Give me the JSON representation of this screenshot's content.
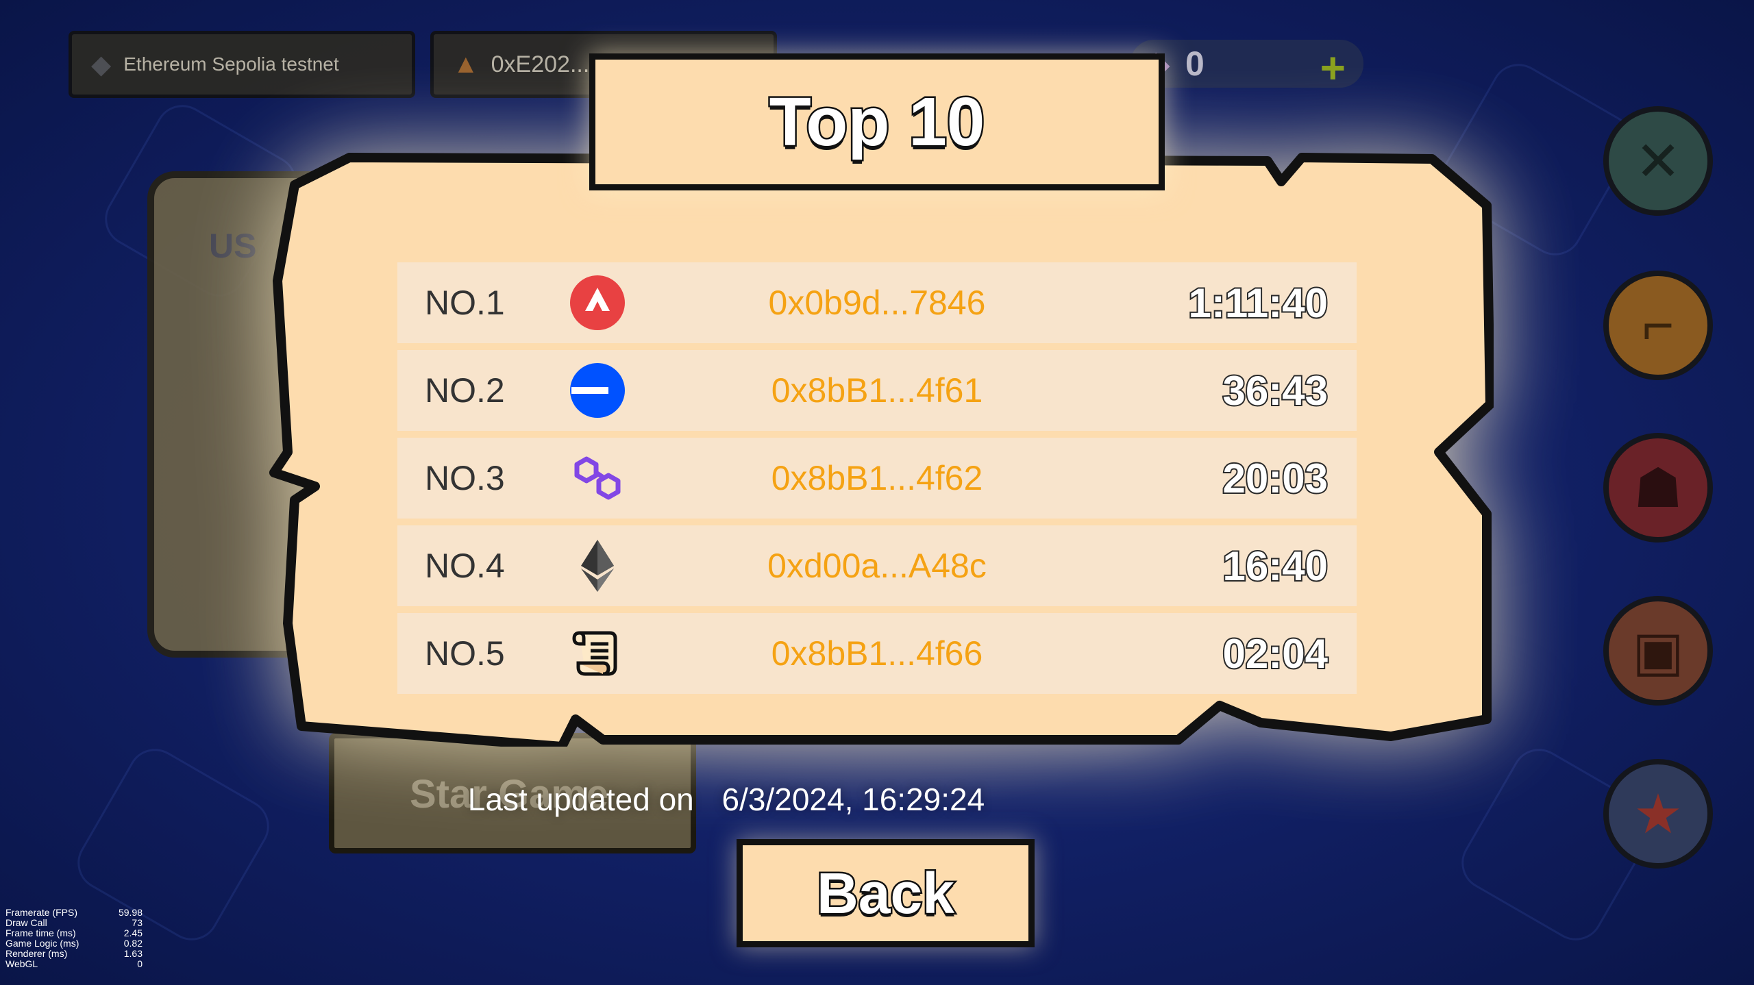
{
  "topbar": {
    "network_label": "Ethereum Sepolia testnet",
    "wallet_label": "0xE202...",
    "gem_count": "0",
    "plus_label": "+"
  },
  "background": {
    "panel_title": "US",
    "star_game_label": "Star Game"
  },
  "leaderboard": {
    "title": "Top 10",
    "rows": [
      {
        "rank": "NO.1",
        "chain_icon": "avalanche-icon",
        "address": "0x0b9d...7846",
        "time": "1:11:40"
      },
      {
        "rank": "NO.2",
        "chain_icon": "base-icon",
        "address": "0x8bB1...4f61",
        "time": "36:43"
      },
      {
        "rank": "NO.3",
        "chain_icon": "polygon-icon",
        "address": "0x8bB1...4f62",
        "time": "20:03"
      },
      {
        "rank": "NO.4",
        "chain_icon": "ethereum-icon",
        "address": "0xd00a...A48c",
        "time": "16:40"
      },
      {
        "rank": "NO.5",
        "chain_icon": "scroll-icon",
        "address": "0x8bB1...4f66",
        "time": "02:04"
      }
    ],
    "updated_prefix": "Last updated on",
    "updated_value": "6/3/2024, 16:29:24",
    "back_label": "Back"
  },
  "side_buttons": [
    {
      "name": "crossed-swords-icon",
      "color": "#2e4a46"
    },
    {
      "name": "blaster-gun-icon",
      "color": "#8a5a20"
    },
    {
      "name": "masked-warrior-icon",
      "color": "#6a2228"
    },
    {
      "name": "gift-box-icon",
      "color": "#6a3a2a"
    },
    {
      "name": "star-icon",
      "color": "#2f3a5a"
    }
  ],
  "stats": [
    {
      "label": "Framerate (FPS)",
      "value": "59.98"
    },
    {
      "label": "Draw Call",
      "value": "73"
    },
    {
      "label": "Frame time (ms)",
      "value": "2.45"
    },
    {
      "label": "Game Logic (ms)",
      "value": "0.82"
    },
    {
      "label": "Renderer (ms)",
      "value": "1.63"
    },
    {
      "label": "WebGL",
      "value": "0"
    }
  ],
  "colors": {
    "parchment": "#fddcae",
    "row": "#f8e4cc",
    "address": "#f5a213",
    "outline": "#111111"
  }
}
